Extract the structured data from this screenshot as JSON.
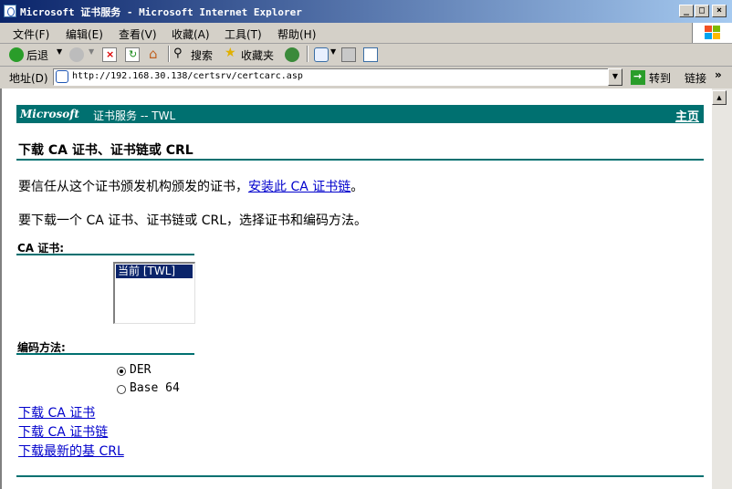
{
  "window": {
    "title": "Microsoft 证书服务 - Microsoft Internet Explorer",
    "minimize": "_",
    "maximize": "□",
    "close": "×"
  },
  "menu": [
    "文件(F)",
    "编辑(E)",
    "查看(V)",
    "收藏(A)",
    "工具(T)",
    "帮助(H)"
  ],
  "toolbar": {
    "back_label": "后退",
    "search_label": "搜索",
    "favorites_label": "收藏夹"
  },
  "address": {
    "label": "地址(D)",
    "url": "http://192.168.30.138/certsrv/certcarc.asp",
    "go_label": "转到",
    "links_label": "链接",
    "more": "»"
  },
  "page": {
    "brand": "Microsoft",
    "service": "证书服务  --   TWL",
    "home_link": "主页",
    "heading": "下载 CA 证书、证书链或 CRL",
    "trust_text": "要信任从这个证书颁发机构颁发的证书，",
    "install_link": "安装此 CA 证书链",
    "trust_end": "。",
    "download_text": "要下载一个 CA 证书、证书链或 CRL，选择证书和编码方法。",
    "ca_label": "CA 证书:",
    "ca_option": "当前 [TWL]",
    "encoding_label": "编码方法:",
    "encodings": [
      {
        "label": "DER",
        "checked": true
      },
      {
        "label": "Base 64",
        "checked": false
      }
    ],
    "links": [
      "下载 CA 证书",
      "下载 CA 证书链",
      "下载最新的基 CRL"
    ]
  },
  "colors": {
    "banner": "#007070",
    "titlebar": "#0a246a",
    "link": "#0000cc"
  }
}
